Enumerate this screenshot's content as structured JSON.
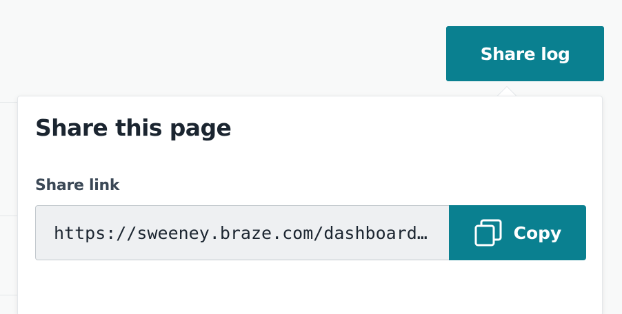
{
  "toolbar": {
    "share_log_label": "Share log"
  },
  "share_popover": {
    "title": "Share this page",
    "link_label": "Share link",
    "link_value": "https://sweeney.braze.com/dashboard/developer_console/message_activity",
    "copy_label": "Copy",
    "copy_icon": "copy-icon"
  },
  "colors": {
    "accent": "#0a8090",
    "title_text": "#1b2530",
    "label_text": "#3b4856",
    "input_bg": "#eef0f2",
    "page_bg": "#f8f9f9"
  }
}
